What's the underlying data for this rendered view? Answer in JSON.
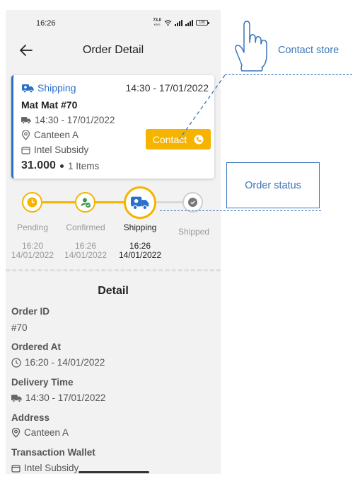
{
  "status_bar": {
    "time": "16:26",
    "net_speed_value": "73.0",
    "net_speed_unit": "KB/S",
    "battery": "100"
  },
  "header": {
    "title": "Order Detail"
  },
  "order_card": {
    "status": "Shipping",
    "delivery_slot": "14:30 - 17/01/2022",
    "shop_name": "Mat Mat #70",
    "delivery_time": "14:30 - 17/01/2022",
    "location": "Canteen A",
    "wallet": "Intel Subsidy",
    "total": "31.000",
    "items": "1 Items",
    "contact_label": "Contact"
  },
  "stepper": {
    "steps": [
      {
        "label": "Pending",
        "time": "16:20",
        "date": "14/01/2022"
      },
      {
        "label": "Confirmed",
        "time": "16:26",
        "date": "14/01/2022"
      },
      {
        "label": "Shipping",
        "time": "16:26",
        "date": "14/01/2022"
      },
      {
        "label": "Shipped"
      }
    ],
    "active_step": "Shipping"
  },
  "detail": {
    "title": "Detail",
    "order_id_label": "Order ID",
    "order_id": "#70",
    "ordered_at_label": "Ordered At",
    "ordered_at": "16:20 - 14/01/2022",
    "delivery_time_label": "Delivery Time",
    "delivery_time": "14:30 - 17/01/2022",
    "address_label": "Address",
    "address": "Canteen A",
    "wallet_label": "Transaction Wallet",
    "wallet": "Intel Subsidy"
  },
  "annotations": {
    "contact_store": "Contact store",
    "order_status": "Order status"
  },
  "colors": {
    "accent_yellow": "#f6b400",
    "accent_blue": "#2a6fc9",
    "annotation_blue": "#3a76b8"
  },
  "icons": [
    "back-arrow-icon",
    "truck-icon",
    "location-pin-icon",
    "wallet-icon",
    "clock-icon",
    "phone-icon",
    "check-icon",
    "hand-pointer-icon"
  ]
}
